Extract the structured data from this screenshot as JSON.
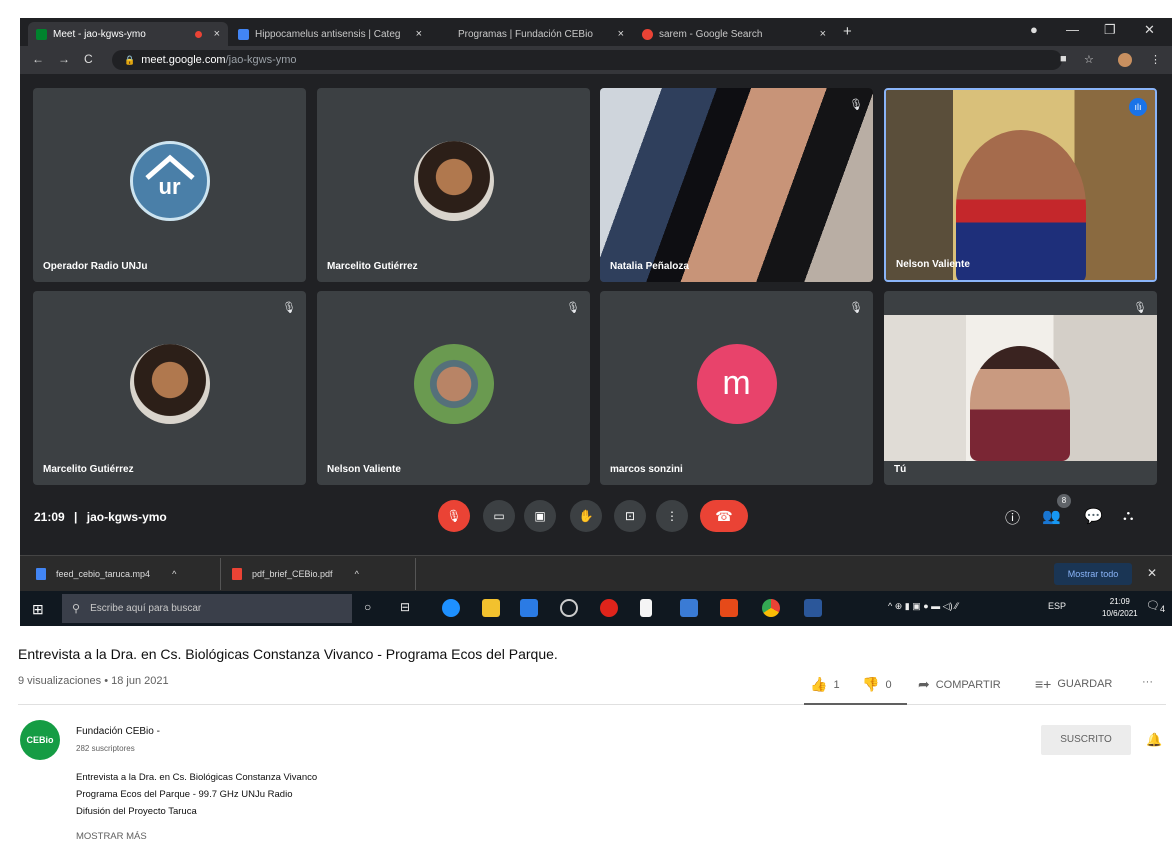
{
  "browser": {
    "tabs": [
      {
        "label": "Meet - jao-kgws-ymo",
        "active": true,
        "favicon_color": "#00832d"
      },
      {
        "label": "Hippocamelus antisensis | Categ",
        "active": false,
        "favicon_color": "#4285f4"
      },
      {
        "label": "Programas | Fundación CEBio",
        "active": false,
        "favicon_color": ""
      },
      {
        "label": "sarem - Google Search",
        "active": false,
        "favicon_color": "#ea4335"
      }
    ],
    "tab_close": "×",
    "new_tab": "+",
    "url_host": "meet.google.com",
    "url_path": "/jao-kgws-ymo"
  },
  "meet": {
    "participants": [
      {
        "name": "Operador Radio UNJu",
        "avatar_text": "ur",
        "muted": false
      },
      {
        "name": "Marcelito Gutiérrez",
        "muted": false
      },
      {
        "name": "Natalia Peñaloza",
        "muted": true
      },
      {
        "name": "Nelson Valiente",
        "speaking": true
      },
      {
        "name": "Marcelito Gutiérrez",
        "muted": true
      },
      {
        "name": "Nelson Valiente",
        "muted": true
      },
      {
        "name": "marcos sonzini",
        "avatar_letter": "m",
        "avatar_color": "#e8436b",
        "muted": true
      },
      {
        "name": "Tú",
        "muted": true
      }
    ],
    "clock": "21:09",
    "separator": "|",
    "meeting_code": "jao-kgws-ymo",
    "people_count": "8"
  },
  "downloads": {
    "items": [
      {
        "label": "feed_cebio_taruca.mp4",
        "icon_color": "#4285f4"
      },
      {
        "label": "pdf_brief_CEBio.pdf",
        "icon_color": "#ea4335"
      }
    ],
    "show_all": "Mostrar todo"
  },
  "taskbar": {
    "search_placeholder": "Escribe aquí para buscar",
    "lang": "ESP",
    "time": "21:09",
    "date": "10/6/2021",
    "notif_count": "4"
  },
  "video": {
    "title": "Entrevista a la Dra. en Cs. Biológicas Constanza Vivanco - Programa Ecos del Parque.",
    "views_date": "9 visualizaciones • 18 jun 2021",
    "likes": "1",
    "dislikes": "0",
    "share": "COMPARTIR",
    "save": "GUARDAR",
    "more": "···"
  },
  "channel": {
    "avatar_text": "CEBio",
    "name": "Fundación CEBio -",
    "subscribers": "282 suscriptores",
    "subscribe_label": "SUSCRITO",
    "description": [
      "Entrevista a la Dra. en Cs. Biológicas Constanza Vivanco",
      "Programa Ecos del Parque - 99.7 GHz UNJu Radio",
      "Difusión del Proyecto Taruca"
    ],
    "show_more": "MOSTRAR MÁS"
  }
}
